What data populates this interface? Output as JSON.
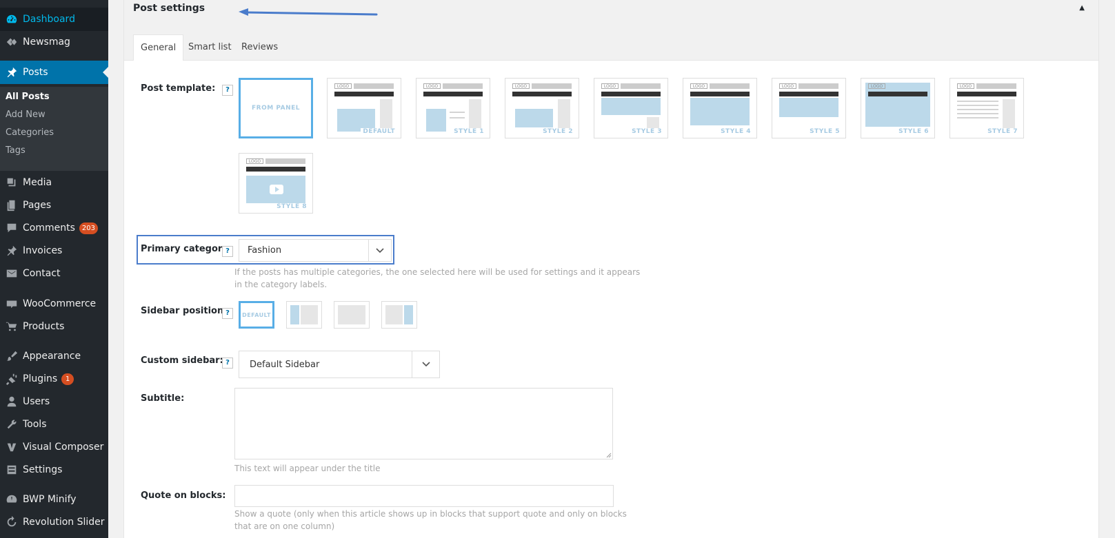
{
  "sidebar": {
    "items": [
      {
        "label": "Dashboard",
        "icon": "dashboard-icon"
      },
      {
        "label": "Newsmag",
        "icon": "newsmag-icon"
      },
      {
        "label": "Posts",
        "icon": "pin-icon"
      },
      {
        "label": "Media",
        "icon": "media-icon"
      },
      {
        "label": "Pages",
        "icon": "pages-icon"
      },
      {
        "label": "Comments",
        "icon": "comment-icon",
        "badge": "203"
      },
      {
        "label": "Invoices",
        "icon": "pin-icon"
      },
      {
        "label": "Contact",
        "icon": "mail-icon"
      },
      {
        "label": "WooCommerce",
        "icon": "woo-icon"
      },
      {
        "label": "Products",
        "icon": "cart-icon"
      },
      {
        "label": "Appearance",
        "icon": "brush-icon"
      },
      {
        "label": "Plugins",
        "icon": "plug-icon",
        "badge": "1"
      },
      {
        "label": "Users",
        "icon": "user-icon"
      },
      {
        "label": "Tools",
        "icon": "wrench-icon"
      },
      {
        "label": "Visual Composer",
        "icon": "vc-icon"
      },
      {
        "label": "Settings",
        "icon": "settings-icon"
      },
      {
        "label": "BWP Minify",
        "icon": "gauge-icon"
      },
      {
        "label": "Revolution Slider",
        "icon": "refresh-icon"
      }
    ],
    "submenu": [
      "All Posts",
      "Add New",
      "Categories",
      "Tags"
    ]
  },
  "metabox": {
    "title": "Post settings",
    "toggle": "▲",
    "tabs": [
      "General",
      "Smart list",
      "Reviews"
    ]
  },
  "form": {
    "help": "?",
    "post_template": {
      "label": "Post template:",
      "options": [
        "FROM PANEL",
        "DEFAULT",
        "STYLE 1",
        "STYLE 2",
        "STYLE 3",
        "STYLE 4",
        "STYLE 5",
        "STYLE 6",
        "STYLE 7",
        "STYLE 8"
      ],
      "logo_text": "LOGO"
    },
    "primary_category": {
      "label": "Primary category:",
      "value": "Fashion",
      "hint_line1": "If the posts has multiple categories, the one selected here will be used for settings and it appears",
      "hint_line2": "in the category labels."
    },
    "sidebar_position": {
      "label": "Sidebar position:",
      "default_label": "DEFAULT"
    },
    "custom_sidebar": {
      "label": "Custom sidebar:",
      "value": "Default Sidebar"
    },
    "subtitle": {
      "label": "Subtitle:",
      "hint": "This text will appear under the title"
    },
    "quote": {
      "label": "Quote on blocks:",
      "hint_line1": "Show a quote (only when this article shows up in blocks that support quote and only on blocks",
      "hint_line2": "that are on one column)"
    }
  },
  "colors": {
    "sidebar_bg": "#23282d",
    "accent": "#0073aa",
    "highlight": "#4a7ccb",
    "badge": "#d54e21"
  }
}
